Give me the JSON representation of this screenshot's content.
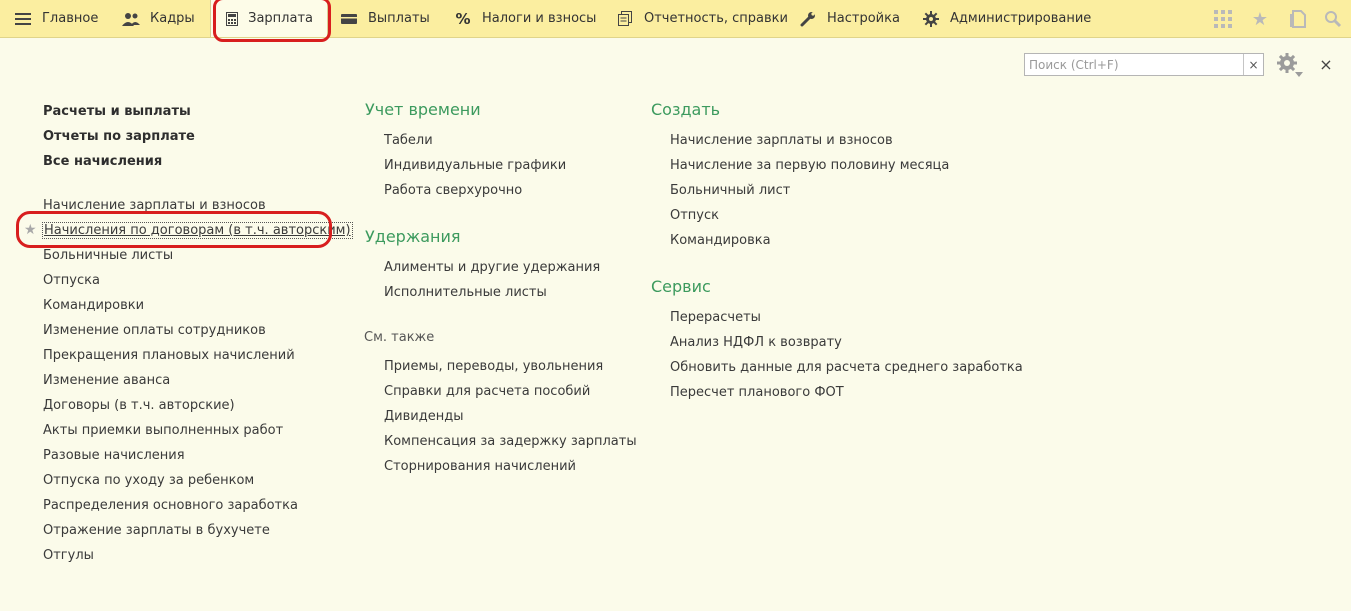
{
  "nav": {
    "items": [
      {
        "label": "Главное",
        "icon": "hamburger-icon"
      },
      {
        "label": "Кадры",
        "icon": "people-icon"
      },
      {
        "label": "Зарплата",
        "icon": "calculator-icon"
      },
      {
        "label": "Выплаты",
        "icon": "wallet-icon"
      },
      {
        "label": "Налоги и взносы",
        "icon": "percent-icon"
      },
      {
        "label": "Отчетность, справки",
        "icon": "documents-icon"
      },
      {
        "label": "Настройка",
        "icon": "wrench-icon"
      },
      {
        "label": "Администрирование",
        "icon": "gear-icon"
      }
    ],
    "active": "Зарплата"
  },
  "search": {
    "placeholder": "Поиск (Ctrl+F)",
    "value": "",
    "clear": "×"
  },
  "close": "×",
  "left": {
    "bold": [
      "Расчеты и выплаты",
      "Отчеты по зарплате",
      "Все начисления"
    ],
    "items": [
      "Начисление зарплаты и взносов",
      "Начисления по договорам (в т.ч. авторским)",
      "Больничные листы",
      "Отпуска",
      "Командировки",
      "Изменение оплаты сотрудников",
      "Прекращения плановых начислений",
      "Изменение аванса",
      "Договоры (в т.ч. авторские)",
      "Акты приемки выполненных работ",
      "Разовые начисления",
      "Отпуска по уходу за ребенком",
      "Распределения основного заработка",
      "Отражение зарплаты в бухучете",
      "Отгулы"
    ]
  },
  "middle": {
    "time": {
      "title": "Учет времени",
      "items": [
        "Табели",
        "Индивидуальные графики",
        "Работа сверхурочно"
      ]
    },
    "deductions": {
      "title": "Удержания",
      "items": [
        "Алименты и другие удержания",
        "Исполнительные листы"
      ]
    },
    "see_also": {
      "title": "См. также",
      "items": [
        "Приемы, переводы, увольнения",
        "Справки для расчета пособий",
        "Дивиденды",
        "Компенсация за задержку зарплаты",
        "Сторнирования начислений"
      ]
    }
  },
  "right": {
    "create": {
      "title": "Создать",
      "items": [
        "Начисление зарплаты и взносов",
        "Начисление за первую половину месяца",
        "Больничный лист",
        "Отпуск",
        "Командировка"
      ]
    },
    "service": {
      "title": "Сервис",
      "items": [
        "Перерасчеты",
        "Анализ НДФЛ к возврату",
        "Обновить данные для расчета среднего заработка",
        "Пересчет планового ФОТ"
      ]
    }
  },
  "colors": {
    "accent_green": "#3c9a5e",
    "topbar": "#fbeea0",
    "highlight_red": "#d81e1e",
    "background": "#fbfbea"
  }
}
